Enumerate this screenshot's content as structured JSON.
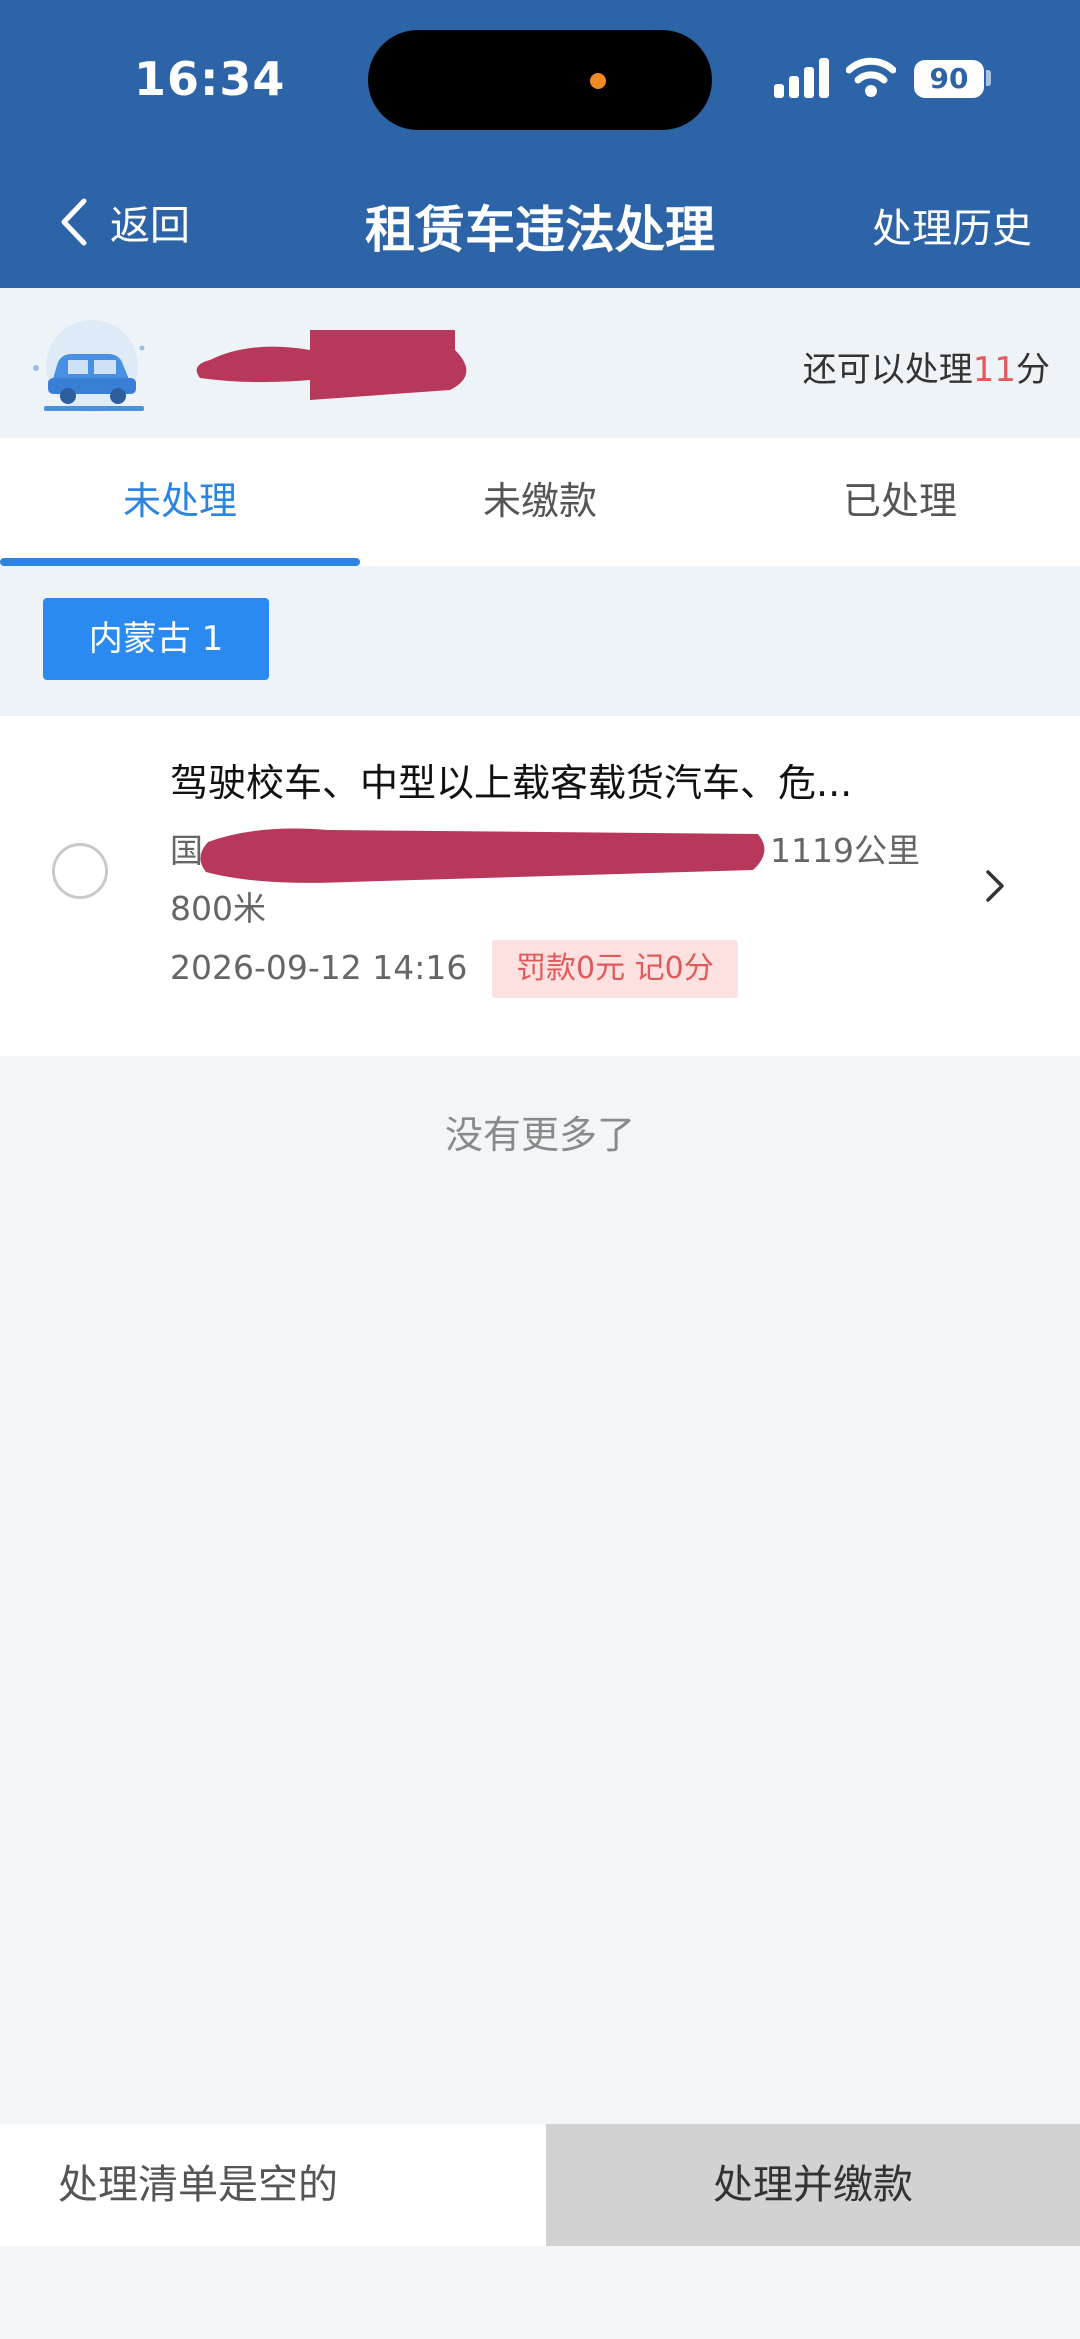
{
  "status_bar": {
    "time": "16:34",
    "battery": "90"
  },
  "nav": {
    "back_label": "返回",
    "title": "租赁车违法处理",
    "history_label": "处理历史"
  },
  "info": {
    "quota_prefix": "还可以处理",
    "quota_value": "11",
    "quota_suffix": "分"
  },
  "tabs": [
    {
      "label": "未处理",
      "active": true
    },
    {
      "label": "未缴款",
      "active": false
    },
    {
      "label": "已处理",
      "active": false
    }
  ],
  "region_chip": "内蒙古 1",
  "violation": {
    "title": "驾驶校车、中型以上载客载货汽车、危...",
    "location_start": "国",
    "location_end": "1119公里",
    "location_line2": "800米",
    "time": "2026-09-12 14:16",
    "penalty": "罚款0元 记0分"
  },
  "list_end": "没有更多了",
  "footer": {
    "empty_label": "处理清单是空的",
    "pay_button": "处理并缴款"
  },
  "colors": {
    "header_bg": "#2d64a7",
    "accent": "#2a84e0",
    "penalty_text": "#e05a5a",
    "redaction": "#b8385c"
  }
}
